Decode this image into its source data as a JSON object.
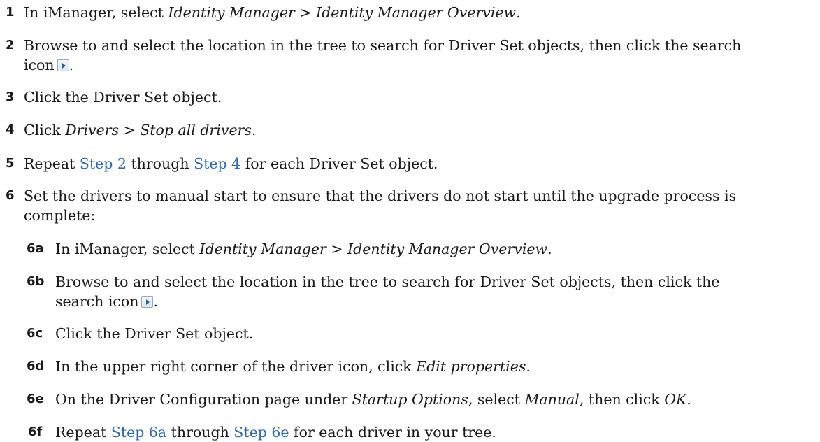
{
  "steps": [
    {
      "num": "1",
      "lines": [
        [
          {
            "t": "In iManager, select "
          },
          {
            "t": "Identity Manager",
            "s": "it"
          },
          {
            "t": " > "
          },
          {
            "t": "Identity Manager Overview",
            "s": "it"
          },
          {
            "t": "."
          }
        ]
      ]
    },
    {
      "num": "2",
      "lines": [
        [
          {
            "t": "Browse to and select the location in the tree to search for Driver Set objects, then click the search"
          }
        ],
        [
          {
            "t": "icon"
          },
          {
            "icon": "search-icon"
          },
          {
            "t": "."
          }
        ]
      ]
    },
    {
      "num": "3",
      "lines": [
        [
          {
            "t": "Click the Driver Set object."
          }
        ]
      ]
    },
    {
      "num": "4",
      "lines": [
        [
          {
            "t": "Click "
          },
          {
            "t": "Drivers",
            "s": "it"
          },
          {
            "t": " > "
          },
          {
            "t": "Stop all drivers",
            "s": "it"
          },
          {
            "t": "."
          }
        ]
      ]
    },
    {
      "num": "5",
      "lines": [
        [
          {
            "t": "Repeat "
          },
          {
            "t": "Step 2",
            "s": "link"
          },
          {
            "t": " through "
          },
          {
            "t": "Step 4",
            "s": "link"
          },
          {
            "t": " for each Driver Set object."
          }
        ]
      ]
    },
    {
      "num": "6",
      "lines": [
        [
          {
            "t": "Set the drivers to manual start to ensure that the drivers do not start until the upgrade process is"
          }
        ],
        [
          {
            "t": "complete:"
          }
        ]
      ]
    },
    {
      "num": "6a",
      "lines": [
        [
          {
            "t": "In iManager, select "
          },
          {
            "t": "Identity Manager",
            "s": "it"
          },
          {
            "t": " > "
          },
          {
            "t": "Identity Manager Overview",
            "s": "it"
          },
          {
            "t": "."
          }
        ]
      ]
    },
    {
      "num": "6b",
      "lines": [
        [
          {
            "t": "Browse to and select the location in the tree to search for Driver Set objects, then click the"
          }
        ],
        [
          {
            "t": "search icon"
          },
          {
            "icon": "search-icon"
          },
          {
            "t": "."
          }
        ]
      ]
    },
    {
      "num": "6c",
      "lines": [
        [
          {
            "t": "Click the Driver Set object."
          }
        ]
      ]
    },
    {
      "num": "6d",
      "lines": [
        [
          {
            "t": "In the upper right corner of the driver icon, click "
          },
          {
            "t": "Edit properties",
            "s": "it"
          },
          {
            "t": "."
          }
        ]
      ]
    },
    {
      "num": "6e",
      "lines": [
        [
          {
            "t": "On the Driver Configuration page under "
          },
          {
            "t": "Startup Options",
            "s": "it"
          },
          {
            "t": ", select "
          },
          {
            "t": "Manual",
            "s": "it"
          },
          {
            "t": ", then click "
          },
          {
            "t": "OK",
            "s": "it"
          },
          {
            "t": "."
          }
        ]
      ]
    },
    {
      "num": "6f",
      "lines": [
        [
          {
            "t": "Repeat "
          },
          {
            "t": "Step 6a",
            "s": "link"
          },
          {
            "t": " through "
          },
          {
            "t": "Step 6e",
            "s": "link"
          },
          {
            "t": " for each driver in your tree."
          }
        ]
      ]
    }
  ]
}
